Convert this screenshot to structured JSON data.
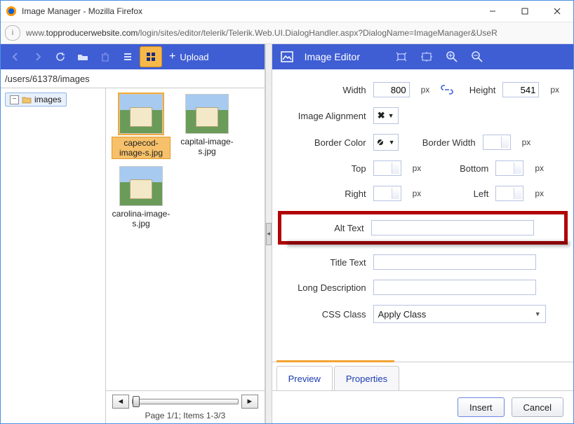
{
  "window": {
    "title": "Image Manager - Mozilla Firefox"
  },
  "address": {
    "prefix": "www.",
    "domain": "topproducerwebsite.com",
    "path": "/login/sites/editor/telerik/Telerik.Web.UI.DialogHandler.aspx?DialogName=ImageManager&UseR"
  },
  "left": {
    "upload_label": "Upload",
    "path": "/users/61378/images",
    "tree_node": "images",
    "thumbs": [
      {
        "caption": "capecod-image-s.jpg",
        "selected": true
      },
      {
        "caption": "capital-image-s.jpg",
        "selected": false
      },
      {
        "caption": "carolina-image-s.jpg",
        "selected": false
      }
    ],
    "pager_text": "Page 1/1; Items 1-3/3"
  },
  "right": {
    "title": "Image Editor",
    "fields": {
      "width_label": "Width",
      "width_value": "800",
      "height_label": "Height",
      "height_value": "541",
      "px": "px",
      "alignment_label": "Image Alignment",
      "alignment_value": "✖",
      "border_color_label": "Border Color",
      "border_width_label": "Border Width",
      "top_label": "Top",
      "bottom_label": "Bottom",
      "right_label": "Right",
      "left_label": "Left",
      "alt_label": "Alt Text",
      "title_label": "Title Text",
      "longdesc_label": "Long Description",
      "css_label": "CSS Class",
      "css_value": "Apply Class"
    },
    "tabs": {
      "preview": "Preview",
      "properties": "Properties"
    },
    "buttons": {
      "insert": "Insert",
      "cancel": "Cancel"
    }
  }
}
